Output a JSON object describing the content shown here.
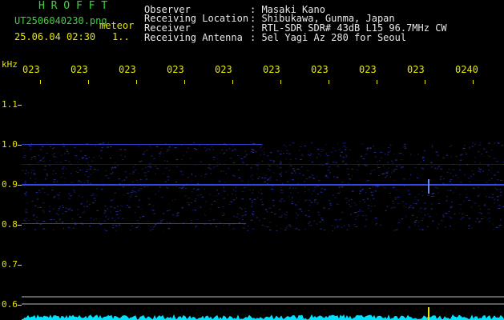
{
  "header": {
    "app_title": "H R O F F T",
    "filename": "UT2506040230.png",
    "tag": "meteor",
    "datetime": "25.06.04 02:30",
    "page": "1..",
    "info": [
      {
        "label": "Observer",
        "value": ": Masaki Kano"
      },
      {
        "label": "Receiving Location",
        "value": ": Shibukawa, Gunma, Japan"
      },
      {
        "label": "Receiver",
        "value": ": RTL-SDR SDR# 43dB L15 96.7MHz CW"
      },
      {
        "label": "Receiving Antenna",
        "value": ": 5el Yagi Az 280 for Seoul"
      }
    ]
  },
  "axes": {
    "y_unit": "kHz",
    "y_ticks": [
      "1.1",
      "1.0",
      "0.9",
      "0.8",
      "0.7",
      "0.6"
    ],
    "x_ticks": [
      "023",
      "023",
      "023",
      "023",
      "023",
      "023",
      "023",
      "023",
      "023",
      "0240"
    ]
  },
  "colors": {
    "text_green": "#3bd43b",
    "text_yellow": "#e6e600",
    "signal_blue": "#3a4cff",
    "noise_cyan": "#00e0ff"
  }
}
